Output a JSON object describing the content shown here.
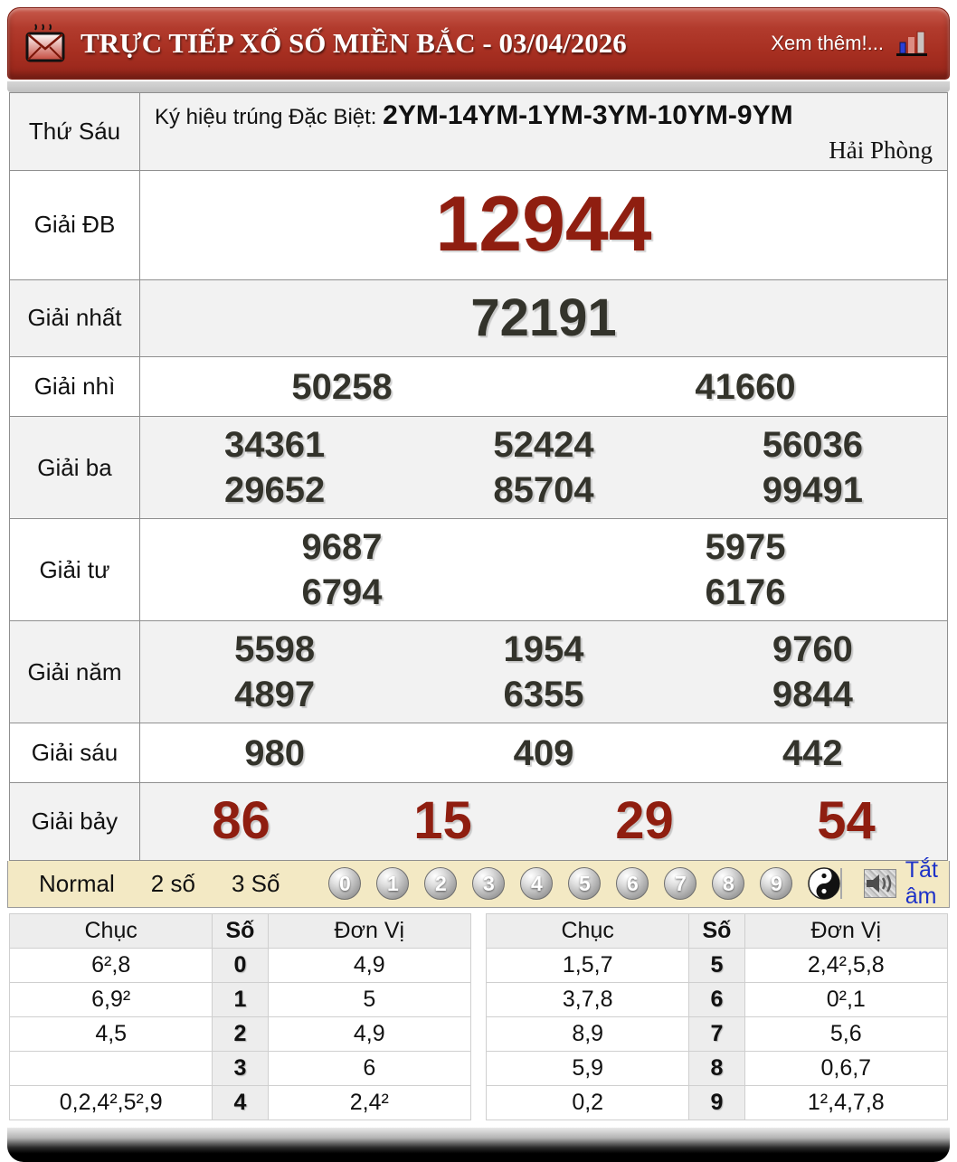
{
  "colors": {
    "header_red": "#a72f21",
    "number_red": "#8f1e10",
    "number_dark": "#33332b",
    "row_gray": "#f2f2f2",
    "control_cream": "#f3e9c4",
    "mute_blue": "#1d32c8"
  },
  "header": {
    "title": "TRỰC TIẾP XỔ SỐ MIỀN BẮC - 03/04/2026",
    "more": "Xem thêm!..."
  },
  "info": {
    "day": "Thứ Sáu",
    "sign_label": "Ký hiệu trúng Đặc Biệt:",
    "sign_code": "2YM-14YM-1YM-3YM-10YM-9YM",
    "province": "Hải Phòng"
  },
  "prizes": {
    "rows": [
      {
        "label": "Giải ĐB",
        "groups": [
          [
            "12944"
          ]
        ]
      },
      {
        "label": "Giải nhất",
        "groups": [
          [
            "72191"
          ]
        ]
      },
      {
        "label": "Giải nhì",
        "groups": [
          [
            "50258",
            "41660"
          ]
        ]
      },
      {
        "label": "Giải ba",
        "groups": [
          [
            "34361",
            "52424",
            "56036"
          ],
          [
            "29652",
            "85704",
            "99491"
          ]
        ]
      },
      {
        "label": "Giải tư",
        "groups": [
          [
            "9687",
            "5975"
          ],
          [
            "6794",
            "6176"
          ]
        ]
      },
      {
        "label": "Giải năm",
        "groups": [
          [
            "5598",
            "1954",
            "9760"
          ],
          [
            "4897",
            "6355",
            "9844"
          ]
        ]
      },
      {
        "label": "Giải sáu",
        "groups": [
          [
            "980",
            "409",
            "442"
          ]
        ]
      },
      {
        "label": "Giải bảy",
        "groups": [
          [
            "86",
            "15",
            "29",
            "54"
          ]
        ]
      }
    ]
  },
  "controls": {
    "modes": [
      "Normal",
      "2 số",
      "3 Số"
    ],
    "balls": [
      "0",
      "1",
      "2",
      "3",
      "4",
      "5",
      "6",
      "7",
      "8",
      "9"
    ],
    "yin_yang_icon": "yin-yang-ball",
    "speaker_icon": "speaker-icon",
    "mute_label": "Tắt âm"
  },
  "digit_table": {
    "headers": [
      "Chục",
      "Số",
      "Đơn Vị"
    ],
    "left_rows": [
      {
        "chuc": "6²,8",
        "so": "0",
        "donvi": "4,9"
      },
      {
        "chuc": "6,9²",
        "so": "1",
        "donvi": "5"
      },
      {
        "chuc": "4,5",
        "so": "2",
        "donvi": "4,9"
      },
      {
        "chuc": "",
        "so": "3",
        "donvi": "6"
      },
      {
        "chuc": "0,2,4²,5²,9",
        "so": "4",
        "donvi": "2,4²"
      }
    ],
    "right_rows": [
      {
        "chuc": "1,5,7",
        "so": "5",
        "donvi": "2,4²,5,8"
      },
      {
        "chuc": "3,7,8",
        "so": "6",
        "donvi": "0²,1"
      },
      {
        "chuc": "8,9",
        "so": "7",
        "donvi": "5,6"
      },
      {
        "chuc": "5,9",
        "so": "8",
        "donvi": "0,6,7"
      },
      {
        "chuc": "0,2",
        "so": "9",
        "donvi": "1²,4,7,8"
      }
    ]
  }
}
